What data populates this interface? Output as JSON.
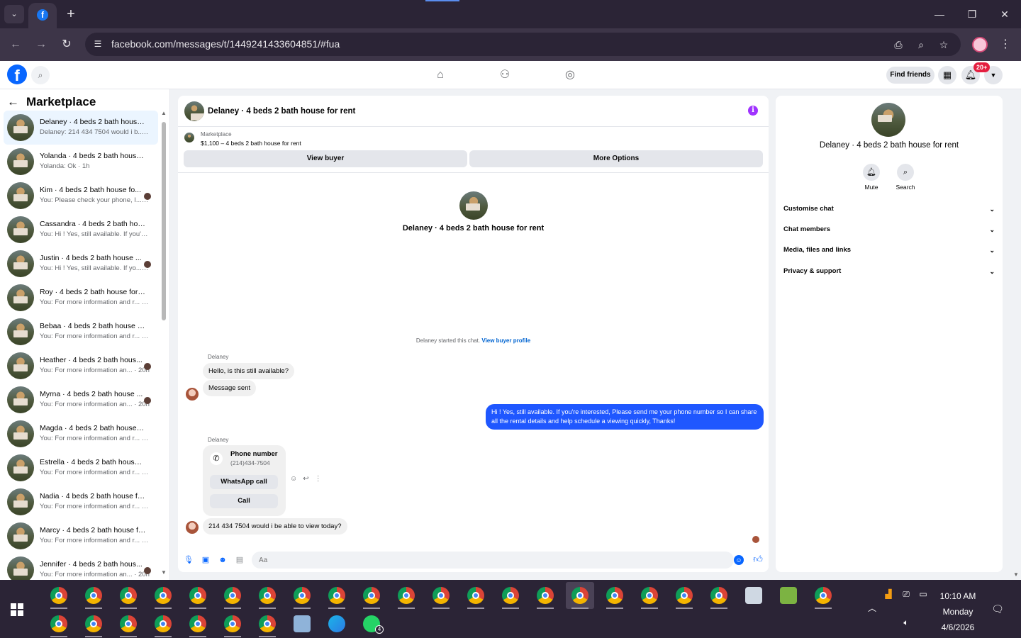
{
  "browser": {
    "url": "facebook.com/messages/t/1449241433604851/#fua",
    "fav_letter": "f",
    "new_tab": "+",
    "tab_dropdown": "⌄",
    "controls": {
      "min": "—",
      "max": "❐",
      "close": "✕"
    }
  },
  "fb": {
    "logo_letter": "f",
    "find_friends": "Find friends",
    "notif_badge": "20+"
  },
  "sidebar": {
    "title": "Marketplace",
    "conversations": [
      {
        "name": "Delaney · 4 beds 2 bath house ...",
        "snippet": "Delaney: 214 434 7504 would i b... · 1m",
        "active": true,
        "seen": false
      },
      {
        "name": "Yolanda · 4 beds 2 bath house f...",
        "snippet": "Yolanda: Ok · 1h",
        "active": false,
        "seen": false
      },
      {
        "name": "Kim · 4 beds 2 bath house fo...",
        "snippet": "You: Please check your phone, I... · 1h",
        "active": false,
        "seen": true
      },
      {
        "name": "Cassandra · 4 beds 2 bath hous...",
        "snippet": "You: Hi ! Yes, still available. If you'r... · 1h",
        "active": false,
        "seen": false
      },
      {
        "name": "Justin · 4 beds 2 bath house ...",
        "snippet": "You: Hi ! Yes, still available. If yo... · 1h",
        "active": false,
        "seen": true
      },
      {
        "name": "Roy · 4 beds 2 bath house for r...",
        "snippet": "You: For more information and r... · 20h",
        "active": false,
        "seen": false
      },
      {
        "name": "Bebaa · 4 beds 2 bath house fo...",
        "snippet": "You: For more information and r... · 20h",
        "active": false,
        "seen": false
      },
      {
        "name": "Heather · 4 beds 2 bath hous...",
        "snippet": "You: For more information an... · 20h",
        "active": false,
        "seen": true
      },
      {
        "name": "Myrna · 4 beds 2 bath house ...",
        "snippet": "You: For more information an... · 20h",
        "active": false,
        "seen": true
      },
      {
        "name": "Magda · 4 beds 2 bath house f...",
        "snippet": "You: For more information and r... · 20h",
        "active": false,
        "seen": false
      },
      {
        "name": "Estrella · 4 beds 2 bath house f...",
        "snippet": "You: For more information and r... · 20h",
        "active": false,
        "seen": false
      },
      {
        "name": "Nadia · 4 beds 2 bath house fo...",
        "snippet": "You: For more information and r... · 20h",
        "active": false,
        "seen": false
      },
      {
        "name": "Marcy · 4 beds 2 bath house fo...",
        "snippet": "You: For more information and r... · 20h",
        "active": false,
        "seen": false
      },
      {
        "name": "Jennifer · 4 beds 2 bath hous...",
        "snippet": "You: For more information an... · 20h",
        "active": false,
        "seen": true
      }
    ]
  },
  "chat": {
    "title": "Delaney · 4 beds 2 bath house for rent",
    "marketplace_label": "Marketplace",
    "listing": "$1,100 – 4 beds 2 bath house for rent",
    "view_buyer": "View buyer",
    "more_options": "More Options",
    "center_title": "Delaney · 4 beds 2 bath house for rent",
    "started_text": "Delaney started this chat.",
    "view_buyer_profile": "View buyer profile",
    "sender_name": "Delaney",
    "msg1": "Hello, is this still available?",
    "msg2": "Message sent",
    "msg_out": "Hi ! Yes, still available. If you're interested, Please send me your phone number so I can share all the rental details and help schedule a viewing quickly, Thanks!",
    "phone_label": "Phone number",
    "phone_number": "(214)434-7504",
    "whatsapp_call": "WhatsApp call",
    "call": "Call",
    "msg_last": "214 434 7504 would i be able to view today?",
    "input_placeholder": "Aa"
  },
  "details": {
    "title": "Delaney · 4 beds 2 bath house for rent",
    "mute": "Mute",
    "search": "Search",
    "rows": [
      "Customise chat",
      "Chat members",
      "Media, files and links",
      "Privacy & support"
    ]
  },
  "taskbar": {
    "time": "10:10 AM",
    "day": "Monday",
    "date": "4/6/2026",
    "whatsapp_badge": "4"
  },
  "colors": {
    "accent": "#0866ff",
    "out_bubble": "#1f57ff",
    "badge": "#e41e3f",
    "info": "#a033ff"
  }
}
